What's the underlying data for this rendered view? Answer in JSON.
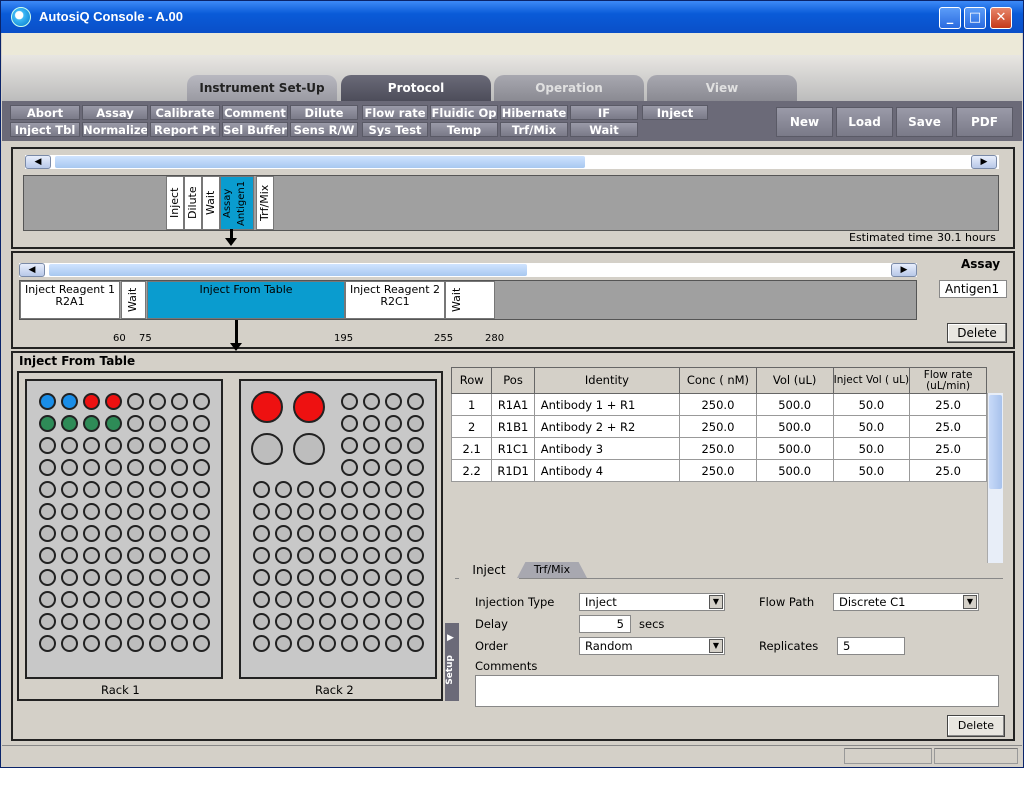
{
  "window": {
    "title": "AutosiQ Console - A.00",
    "minimize": "_",
    "maximize": "□",
    "close": "✕"
  },
  "main_tabs": [
    "Instrument Set-Up",
    "Protocol",
    "Operation",
    "View"
  ],
  "command_buttons": {
    "row1": [
      "Abort",
      "Assay",
      "Calibrate",
      "Comment",
      "Dilute",
      "Flow rate",
      "Fluidic Op",
      "Hibernate",
      "IF",
      "Inject"
    ],
    "row2": [
      "Inject Tbl",
      "Normalize",
      "Report Pt",
      "Sel Buffer",
      "Sens R/W",
      "Sys Test",
      "Temp",
      "Trf/Mix",
      "Wait"
    ]
  },
  "file_buttons": [
    "New",
    "Load",
    "Save",
    "PDF"
  ],
  "protocol_strip": {
    "steps": [
      "Inject",
      "Dilute",
      "Wait",
      "Assay Antigen1",
      "Trf/Mix"
    ],
    "estimated_label": "Estimated time",
    "estimated_value": "30.1 hours"
  },
  "assay_strip": {
    "steps": [
      {
        "label": "Inject Reagent 1 R2A1"
      },
      {
        "label": "Wait"
      },
      {
        "label": "Inject From Table"
      },
      {
        "label": "Inject Reagent 2 R2C1"
      },
      {
        "label": "Wait"
      }
    ],
    "ticks": [
      "60",
      "75",
      "195",
      "255",
      "280"
    ],
    "assay_label": "Assay",
    "assay_name": "Antigen1",
    "delete_label": "Delete"
  },
  "inject_panel": {
    "title": "Inject From Table",
    "rack1_label": "Rack 1",
    "rack2_label": "Rack 2",
    "setup_label": "Setup",
    "table": {
      "headers": [
        "Row",
        "Pos",
        "Identity",
        "Conc ( nM)",
        "Vol (uL)",
        "Inject Vol ( uL)",
        "Flow rate (uL/min)"
      ],
      "rows": [
        [
          "1",
          "R1A1",
          "Antibody 1 + R1",
          "250.0",
          "500.0",
          "50.0",
          "25.0"
        ],
        [
          "2",
          "R1B1",
          "Antibody 2 + R2",
          "250.0",
          "500.0",
          "50.0",
          "25.0"
        ],
        [
          "2.1",
          "R1C1",
          "Antibody 3",
          "250.0",
          "500.0",
          "50.0",
          "25.0"
        ],
        [
          "2.2",
          "R1D1",
          "Antibody 4",
          "250.0",
          "500.0",
          "50.0",
          "25.0"
        ]
      ]
    },
    "sub_tabs": [
      "Inject",
      "Trf/Mix"
    ],
    "form": {
      "injection_type_label": "Injection Type",
      "injection_type_value": "Inject",
      "flow_path_label": "Flow Path",
      "flow_path_value": "Discrete C1",
      "delay_label": "Delay",
      "delay_value": "5",
      "delay_unit": "secs",
      "order_label": "Order",
      "order_value": "Random",
      "replicates_label": "Replicates",
      "replicates_value": "5",
      "comments_label": "Comments",
      "comments_value": ""
    },
    "delete_label": "Delete"
  },
  "colors": {
    "selected_step": "#0a9ccf",
    "well_blue": "#1a8ee8",
    "well_red": "#ee1111",
    "well_green": "#2e8b57",
    "well_empty": "#bdbdbd"
  }
}
